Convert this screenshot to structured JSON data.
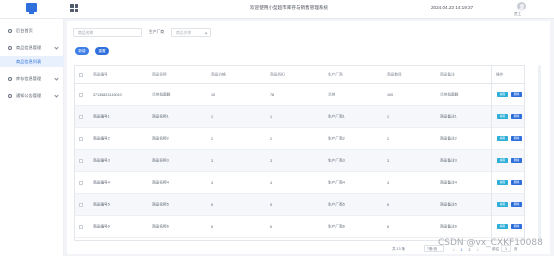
{
  "header": {
    "title": "欢迎使用小型超市库存与销售管理系统",
    "datetime": "2024.04.23 14:19:37",
    "username": "员工"
  },
  "sidebar": {
    "items": [
      {
        "label": "后台首页",
        "icon": "home-icon"
      },
      {
        "label": "商品信息管理",
        "icon": "goods-icon"
      },
      {
        "label": "商品信息列表",
        "icon": ""
      },
      {
        "label": "库存信息管理",
        "icon": "inventory-icon"
      },
      {
        "label": "通知公告管理",
        "icon": "notice-icon"
      }
    ]
  },
  "search": {
    "name_placeholder": "商品名称",
    "manufacturer_label": "生产厂商",
    "manufacturer_placeholder": "商品名称"
  },
  "toolbar": {
    "add_label": "新增",
    "reset_label": "重置"
  },
  "table": {
    "headers": [
      "商品编号",
      "商品名称",
      "商品价格",
      "商品折扣",
      "生产厂商",
      "商品数目",
      "商品备注",
      "操作"
    ],
    "rows": [
      [
        "37136823143010",
        "兰州拉面鲜",
        "10",
        "78",
        "兰州",
        "100",
        "兰州拉面鲜",
        "编辑",
        "删除"
      ],
      [
        "商品编号1",
        "商品名称1",
        "1",
        "1",
        "生产厂商1",
        "1",
        "商品备注1",
        "编辑",
        "删除"
      ],
      [
        "商品编号2",
        "商品名称2",
        "2",
        "2",
        "生产厂商2",
        "2",
        "商品备注2",
        "编辑",
        "删除"
      ],
      [
        "商品编号3",
        "商品名称3",
        "3",
        "3",
        "生产厂商3",
        "3",
        "商品备注3",
        "编辑",
        "删除"
      ],
      [
        "商品编号4",
        "商品名称4",
        "4",
        "4",
        "生产厂商4",
        "4",
        "商品备注4",
        "编辑",
        "删除"
      ],
      [
        "商品编号5",
        "商品名称5",
        "5",
        "5",
        "生产厂商5",
        "5",
        "商品备注5",
        "编辑",
        "删除"
      ],
      [
        "商品编号6",
        "商品名称6",
        "6",
        "6",
        "生产厂商6",
        "6",
        "商品备注6",
        "编辑",
        "删除"
      ]
    ]
  },
  "pagination": {
    "total": "共 13 条",
    "page_size": "7条/页",
    "prev": "<",
    "pages": [
      "1",
      "2"
    ],
    "next": ">",
    "goto_label": "前往",
    "goto_value": "1",
    "page_suffix": "页"
  },
  "watermark": "CSDN @vx_CXKF10088",
  "colors": {
    "primary": "#2f6fdc",
    "edit_button": "#2eaed8",
    "sidebar_active_bg": "#e8f0fd"
  }
}
